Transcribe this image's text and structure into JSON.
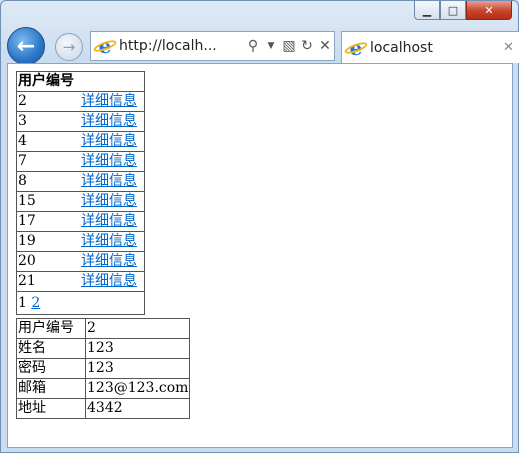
{
  "browser": {
    "address_url": "http://localh...",
    "tab_title": "localhost",
    "caption": {
      "minimize": "▭",
      "maximize": "□",
      "close": "✕"
    }
  },
  "user_list": {
    "header": "用户编号",
    "rows": [
      {
        "id": "2",
        "link": "详细信息"
      },
      {
        "id": "3",
        "link": "详细信息"
      },
      {
        "id": "4",
        "link": "详细信息"
      },
      {
        "id": "7",
        "link": "详细信息"
      },
      {
        "id": "8",
        "link": "详细信息"
      },
      {
        "id": "15",
        "link": "详细信息"
      },
      {
        "id": "17",
        "link": "详细信息"
      },
      {
        "id": "19",
        "link": "详细信息"
      },
      {
        "id": "20",
        "link": "详细信息"
      },
      {
        "id": "21",
        "link": "详细信息"
      }
    ],
    "pager": {
      "current": "1",
      "next": "2"
    }
  },
  "detail": {
    "rows": [
      {
        "label": "用户编号",
        "value": "2"
      },
      {
        "label": "姓名",
        "value": "123"
      },
      {
        "label": "密码",
        "value": "123"
      },
      {
        "label": "邮箱",
        "value": "123@123.com"
      },
      {
        "label": "地址",
        "value": "4342"
      }
    ]
  },
  "icons": {
    "back": "back-arrow-icon",
    "forward": "forward-arrow-icon",
    "ie": "ie-logo-icon",
    "search": "search-icon",
    "dropdown": "dropdown-arrow-icon",
    "compat": "compatibility-view-icon",
    "refresh": "refresh-icon",
    "stop": "stop-icon",
    "tab_close": "tab-close-icon"
  }
}
